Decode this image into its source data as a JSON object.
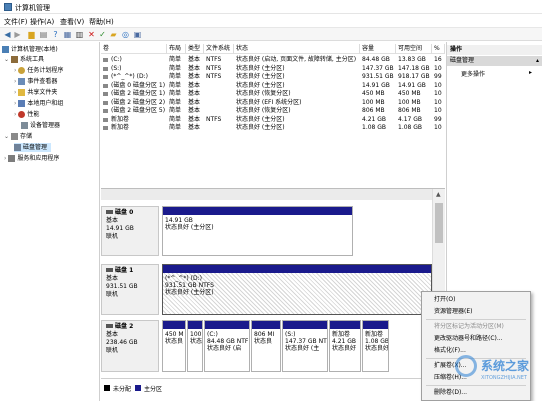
{
  "window": {
    "title": "计算机管理"
  },
  "menu": [
    "文件(F)",
    "操作(A)",
    "查看(V)",
    "帮助(H)"
  ],
  "toolbar": {
    "icons": [
      "back-icon",
      "forward-icon",
      "up-folder-icon",
      "properties-icon",
      "help-icon",
      "list-icon",
      "delete-icon",
      "checkmark-icon",
      "open-folder-icon",
      "search-icon",
      "refresh-icon"
    ]
  },
  "tree": [
    {
      "label": "计算机管理(本地)",
      "level": 0
    },
    {
      "label": "系统工具",
      "level": 1
    },
    {
      "label": "任务计划程序",
      "level": 2
    },
    {
      "label": "事件查看器",
      "level": 2
    },
    {
      "label": "共享文件夹",
      "level": 2
    },
    {
      "label": "本地用户和组",
      "level": 2
    },
    {
      "label": "性能",
      "level": 2
    },
    {
      "label": "设备管理器",
      "level": 2
    },
    {
      "label": "存储",
      "level": 1
    },
    {
      "label": "磁盘管理",
      "level": 2,
      "selected": true
    },
    {
      "label": "服务和应用程序",
      "level": 1
    }
  ],
  "volumes": {
    "headers": [
      "卷",
      "布局",
      "类型",
      "文件系统",
      "状态",
      "容量",
      "可用空间",
      "%"
    ],
    "rows": [
      [
        "(C:)",
        "简单",
        "基本",
        "NTFS",
        "状态良好 (启动, 页面文件, 故障转储, 主分区)",
        "84.48 GB",
        "13.83 GB",
        "16"
      ],
      [
        "(S:)",
        "简单",
        "基本",
        "NTFS",
        "状态良好 (主分区)",
        "147.37 GB",
        "147.18 GB",
        "10"
      ],
      [
        "(*^_^*) (D:)",
        "简单",
        "基本",
        "NTFS",
        "状态良好 (主分区)",
        "931.51 GB",
        "918.17 GB",
        "99"
      ],
      [
        "(磁盘 0 磁盘分区 1)",
        "简单",
        "基本",
        "",
        "状态良好 (主分区)",
        "14.91 GB",
        "14.91 GB",
        "10"
      ],
      [
        "(磁盘 2 磁盘分区 1)",
        "简单",
        "基本",
        "",
        "状态良好 (恢复分区)",
        "450 MB",
        "450 MB",
        "10"
      ],
      [
        "(磁盘 2 磁盘分区 2)",
        "简单",
        "基本",
        "",
        "状态良好 (EFI 系统分区)",
        "100 MB",
        "100 MB",
        "10"
      ],
      [
        "(磁盘 2 磁盘分区 5)",
        "简单",
        "基本",
        "",
        "状态良好 (恢复分区)",
        "806 MB",
        "806 MB",
        "10"
      ],
      [
        "新加卷",
        "简单",
        "基本",
        "NTFS",
        "状态良好 (主分区)",
        "4.21 GB",
        "4.17 GB",
        "99"
      ],
      [
        "新加卷",
        "简单",
        "基本",
        "",
        "状态良好 (主分区)",
        "1.08 GB",
        "1.08 GB",
        "10"
      ]
    ]
  },
  "disks": [
    {
      "name": "磁盘 0",
      "type": "基本",
      "size": "14.91 GB",
      "state": "联机",
      "parts": [
        {
          "l1": "",
          "l2": "14.91 GB",
          "l3": "状态良好 (主分区)"
        }
      ]
    },
    {
      "name": "磁盘 1",
      "type": "基本",
      "size": "931.51 GB",
      "state": "联机",
      "parts": [
        {
          "l1": "(*^_^*) (D:)",
          "l2": "931.51 GB NTFS",
          "l3": "状态良好 (主分区)"
        }
      ]
    },
    {
      "name": "磁盘 2",
      "type": "基本",
      "size": "238.46 GB",
      "state": "联机",
      "parts": [
        {
          "l1": "",
          "l2": "450 M",
          "l3": "状态良"
        },
        {
          "l1": "",
          "l2": "100 M",
          "l3": "状态良"
        },
        {
          "l1": "(C:)",
          "l2": "84.48 GB NTF",
          "l3": "状态良好 (启"
        },
        {
          "l1": "",
          "l2": "806 MI",
          "l3": "状态良"
        },
        {
          "l1": "(S:)",
          "l2": "147.37 GB NT",
          "l3": "状态良好 (主"
        },
        {
          "l1": "新加卷",
          "l2": "4.21 GB",
          "l3": "状态良好"
        },
        {
          "l1": "新加卷",
          "l2": "1.08 GB",
          "l3": "状态良好"
        }
      ]
    }
  ],
  "legend": {
    "unallocated": "未分配",
    "primary": "主分区"
  },
  "actions": {
    "header": "操作",
    "section": "磁盘管理",
    "more": "更多操作"
  },
  "context_menu": {
    "items": [
      "打开(O)",
      "资源管理器(E)",
      "将分区标记为活动分区(M)",
      "更改驱动器号和路径(C)...",
      "格式化(F)...",
      "扩展卷(X)...",
      "压缩卷(H)...",
      "删除卷(D)..."
    ],
    "disabled": [
      2
    ]
  },
  "watermark": {
    "text": "系统之家",
    "url": "XITONGZHIJIA.NET"
  },
  "colors": {
    "primary_bar": "#1a1a8c",
    "selection": "#cce8ff",
    "action_header": "#d9d9d9"
  }
}
